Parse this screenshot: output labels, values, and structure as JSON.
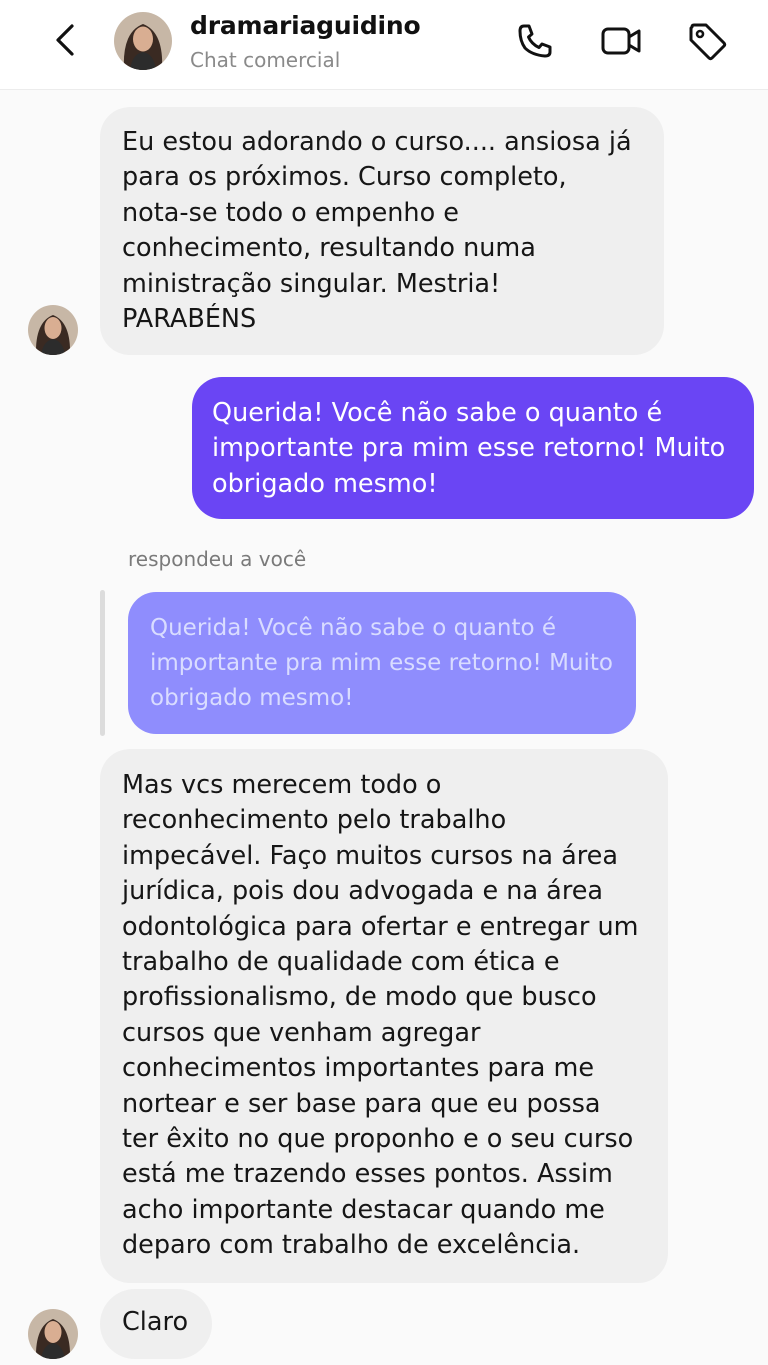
{
  "header": {
    "username": "dramariaguidino",
    "subtitle": "Chat comercial",
    "icons": [
      "chevron-left-icon",
      "phone-icon",
      "video-camera-icon",
      "tag-icon"
    ]
  },
  "messages": [
    {
      "direction": "incoming",
      "lines": [
        "Eu estou adorando o curso.... ansiosa já",
        "para os próximos. Curso completo,",
        "nota-se todo o empenho e",
        "conhecimento, resultando numa",
        "ministração singular. Mestria!",
        "PARABÉNS"
      ]
    },
    {
      "direction": "outgoing",
      "lines": [
        "Querida! Você não sabe o quanto é",
        "importante pra mim esse retorno! Muito",
        "obrigado mesmo!"
      ]
    },
    {
      "reply_note": "respondeu a você",
      "quoted_lines": [
        "Querida! Você não sabe o quanto é",
        "importante pra mim esse retorno! Muito",
        "obrigado mesmo!"
      ]
    },
    {
      "direction": "incoming",
      "lines": [
        "Mas vcs merecem todo o",
        "reconhecimento pelo trabalho",
        "impecável. Faço muitos cursos na área",
        "jurídica, pois dou advogada e na área",
        "odontológica para ofertar e entregar um",
        "trabalho de qualidade com ética e",
        "profissionalismo, de modo que busco",
        "cursos que venham agregar",
        "conhecimentos importantes para me",
        "nortear e ser base para que eu possa",
        "ter êxito no que proponho e o seu curso",
        "está me trazendo esses pontos. Assim",
        "acho importante destacar quando me",
        "deparo com trabalho de excelência."
      ]
    },
    {
      "direction": "incoming",
      "lines": [
        "Claro"
      ]
    }
  ],
  "colors": {
    "outgoing_bubble": "#6a45f4",
    "quoted_bubble": "#8f8dfd",
    "incoming_bubble": "#efefef"
  }
}
